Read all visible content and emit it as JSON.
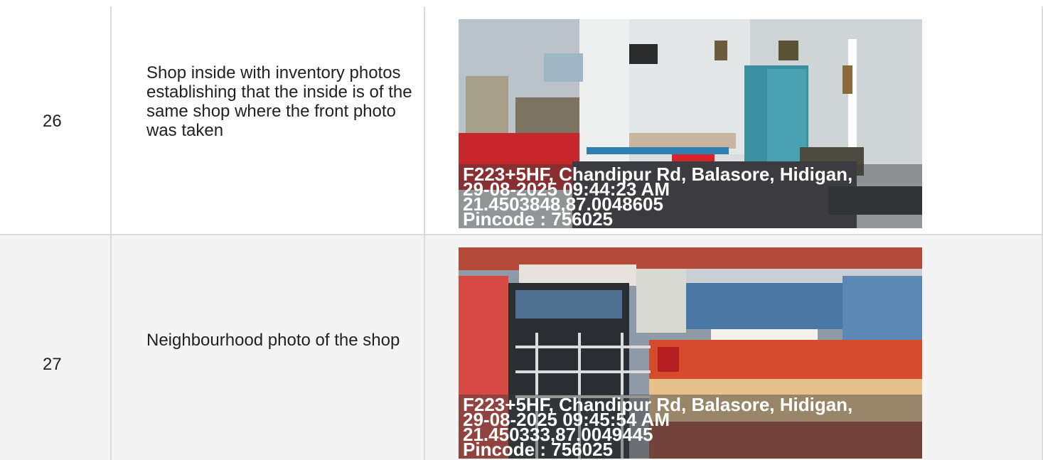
{
  "rows": [
    {
      "number": "26",
      "description": "Shop inside with inventory photos establishing that the inside is of the same shop where the front photo was taken",
      "photo": {
        "subject": "Shop interior",
        "stamp": {
          "address": "F223+5HF, Chandipur Rd, Balasore, Hidigan,",
          "datetime": "29-08-2025 09:44:23 AM",
          "coords": "21.4503848,87.0048605",
          "pincode": "Pincode : 756025"
        }
      }
    },
    {
      "number": "27",
      "description": "Neighbourhood photo of the shop",
      "photo": {
        "subject": "Shop front neighbourhood",
        "stamp": {
          "address": "F223+5HF, Chandipur Rd, Balasore, Hidigan,",
          "datetime": "29-08-2025 09:45:54 AM",
          "coords": "21.450333,87.0049445",
          "pincode": "Pincode : 756025"
        }
      }
    }
  ]
}
